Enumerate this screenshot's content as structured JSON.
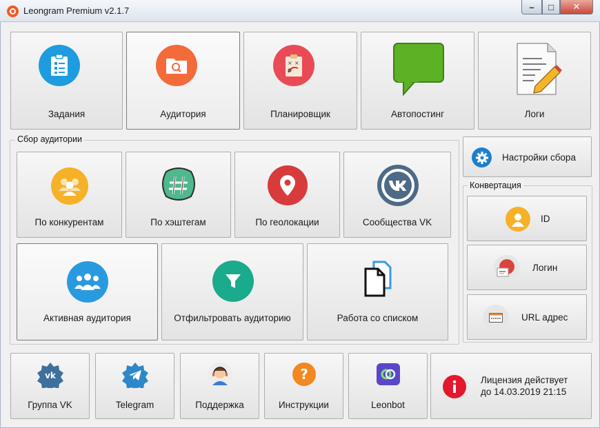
{
  "window": {
    "title": "Leongram Premium v2.1.7",
    "controls": {
      "minimize": "–",
      "maximize": "□",
      "close": "✕"
    }
  },
  "top_nav": [
    {
      "label": "Задания",
      "icon": "clipboard-icon"
    },
    {
      "label": "Аудитория",
      "icon": "folder-search-icon",
      "selected": true
    },
    {
      "label": "Планировщик",
      "icon": "planner-board-icon"
    },
    {
      "label": "Автопостинг",
      "icon": "speech-bubble-icon"
    },
    {
      "label": "Логи",
      "icon": "notepad-pencil-icon"
    }
  ],
  "collect": {
    "title": "Сбор аудитории",
    "row1": [
      {
        "label": "По конкурентам",
        "icon": "people-group-icon"
      },
      {
        "label": "По хэштегам",
        "icon": "hashtag-icon"
      },
      {
        "label": "По геолокации",
        "icon": "map-pin-icon"
      },
      {
        "label": "Сообщества VK",
        "icon": "vk-logo-icon"
      }
    ],
    "row2": [
      {
        "label": "Активная аудитория",
        "icon": "active-audience-icon",
        "selected": true
      },
      {
        "label": "Отфильтровать аудиторию",
        "icon": "filter-icon"
      },
      {
        "label": "Работа со списком",
        "icon": "documents-icon"
      }
    ]
  },
  "settings_button": {
    "label": "Настройки сбора",
    "icon": "gear-icon"
  },
  "conversion": {
    "title": "Конвертация",
    "items": [
      {
        "label": "ID",
        "icon": "user-id-icon"
      },
      {
        "label": "Логин",
        "icon": "login-card-icon"
      },
      {
        "label": "URL адрес",
        "icon": "url-browser-icon"
      }
    ]
  },
  "bottom_bar": [
    {
      "label": "Группа VK",
      "icon": "vk-badge-icon"
    },
    {
      "label": "Telegram",
      "icon": "telegram-badge-icon"
    },
    {
      "label": "Поддержка",
      "icon": "support-headset-icon"
    },
    {
      "label": "Инструкции",
      "icon": "question-icon"
    },
    {
      "label": "Leonbot",
      "icon": "leonbot-icon"
    }
  ],
  "license": {
    "line1": "Лицензия действует",
    "line2": "до 14.03.2019 21:15",
    "icon": "info-icon"
  },
  "colors": {
    "task_blue": "#1f9be0",
    "audience_orange": "#f36b3b",
    "planner_red": "#e94b56",
    "autopost_green": "#5db125",
    "people_yellow": "#f5b229",
    "hashtag_teal": "#4fb88c",
    "geo_red": "#d83b3b",
    "vk_slate": "#4d6a87",
    "active_blue": "#2a9ae0",
    "filter_teal": "#1aaa8c",
    "settings_blue": "#1c7fcc",
    "license_red": "#e3182d"
  }
}
